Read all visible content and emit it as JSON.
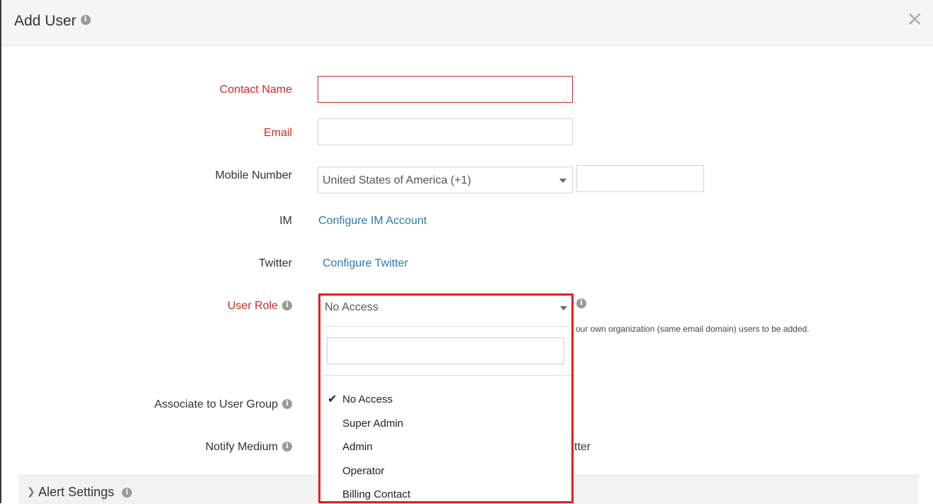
{
  "dialog": {
    "title": "Add User",
    "close_glyph": "✕"
  },
  "fields": {
    "contact_name": {
      "label": "Contact Name",
      "value": ""
    },
    "email": {
      "label": "Email",
      "value": ""
    },
    "mobile": {
      "label": "Mobile Number",
      "country": "United States of America (+1)",
      "number": ""
    },
    "im": {
      "label": "IM",
      "link": "Configure IM Account"
    },
    "twitter": {
      "label": "Twitter",
      "link": "Configure Twitter"
    },
    "user_role": {
      "label": "User Role",
      "selected": "No Access",
      "hint_partial": "our own organization (same email domain) users to be added.",
      "search_value": "",
      "options": [
        "No Access",
        "Super Admin",
        "Admin",
        "Operator",
        "Billing Contact"
      ],
      "check_glyph": "✔"
    },
    "user_group": {
      "label": "Associate to User Group"
    },
    "notify_medium": {
      "label": "Notify Medium",
      "partial_text": "tter"
    }
  },
  "alert_settings": {
    "label": "Alert Settings",
    "chevron_glyph": "❯"
  },
  "icons": {
    "info": "i"
  },
  "colors": {
    "required": "#d12a1f",
    "link": "#2a7ab8",
    "highlight": "#e02020"
  }
}
